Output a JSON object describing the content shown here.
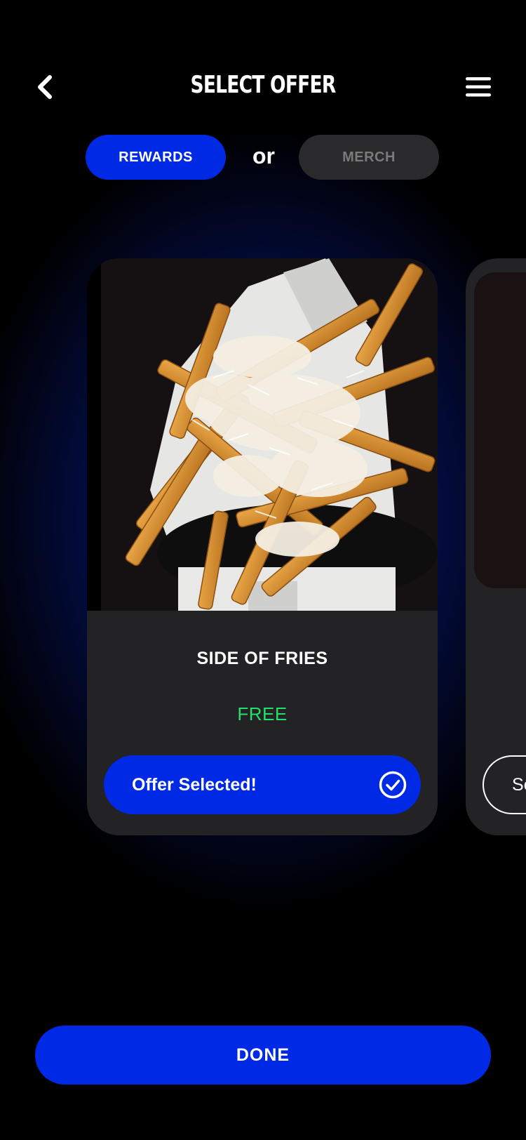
{
  "header": {
    "title": "SELECT OFFER",
    "back_icon": "chevron-left-icon",
    "menu_icon": "hamburger-menu-icon"
  },
  "toggle": {
    "rewards_label": "REWARDS",
    "separator": "or",
    "merch_label": "MERCH",
    "active": "REWARDS"
  },
  "offers": [
    {
      "name": "SIDE OF FRIES",
      "price": "FREE",
      "button_label": "Offer Selected!",
      "selected": true,
      "image": "parmesan-fries-photo"
    },
    {
      "button_label": "Se",
      "selected": false
    }
  ],
  "footer": {
    "done_label": "DONE"
  },
  "colors": {
    "accent": "#0029e6",
    "price": "#22e06a",
    "card": "#232325",
    "inactive_toggle": "#2a2a2c"
  }
}
